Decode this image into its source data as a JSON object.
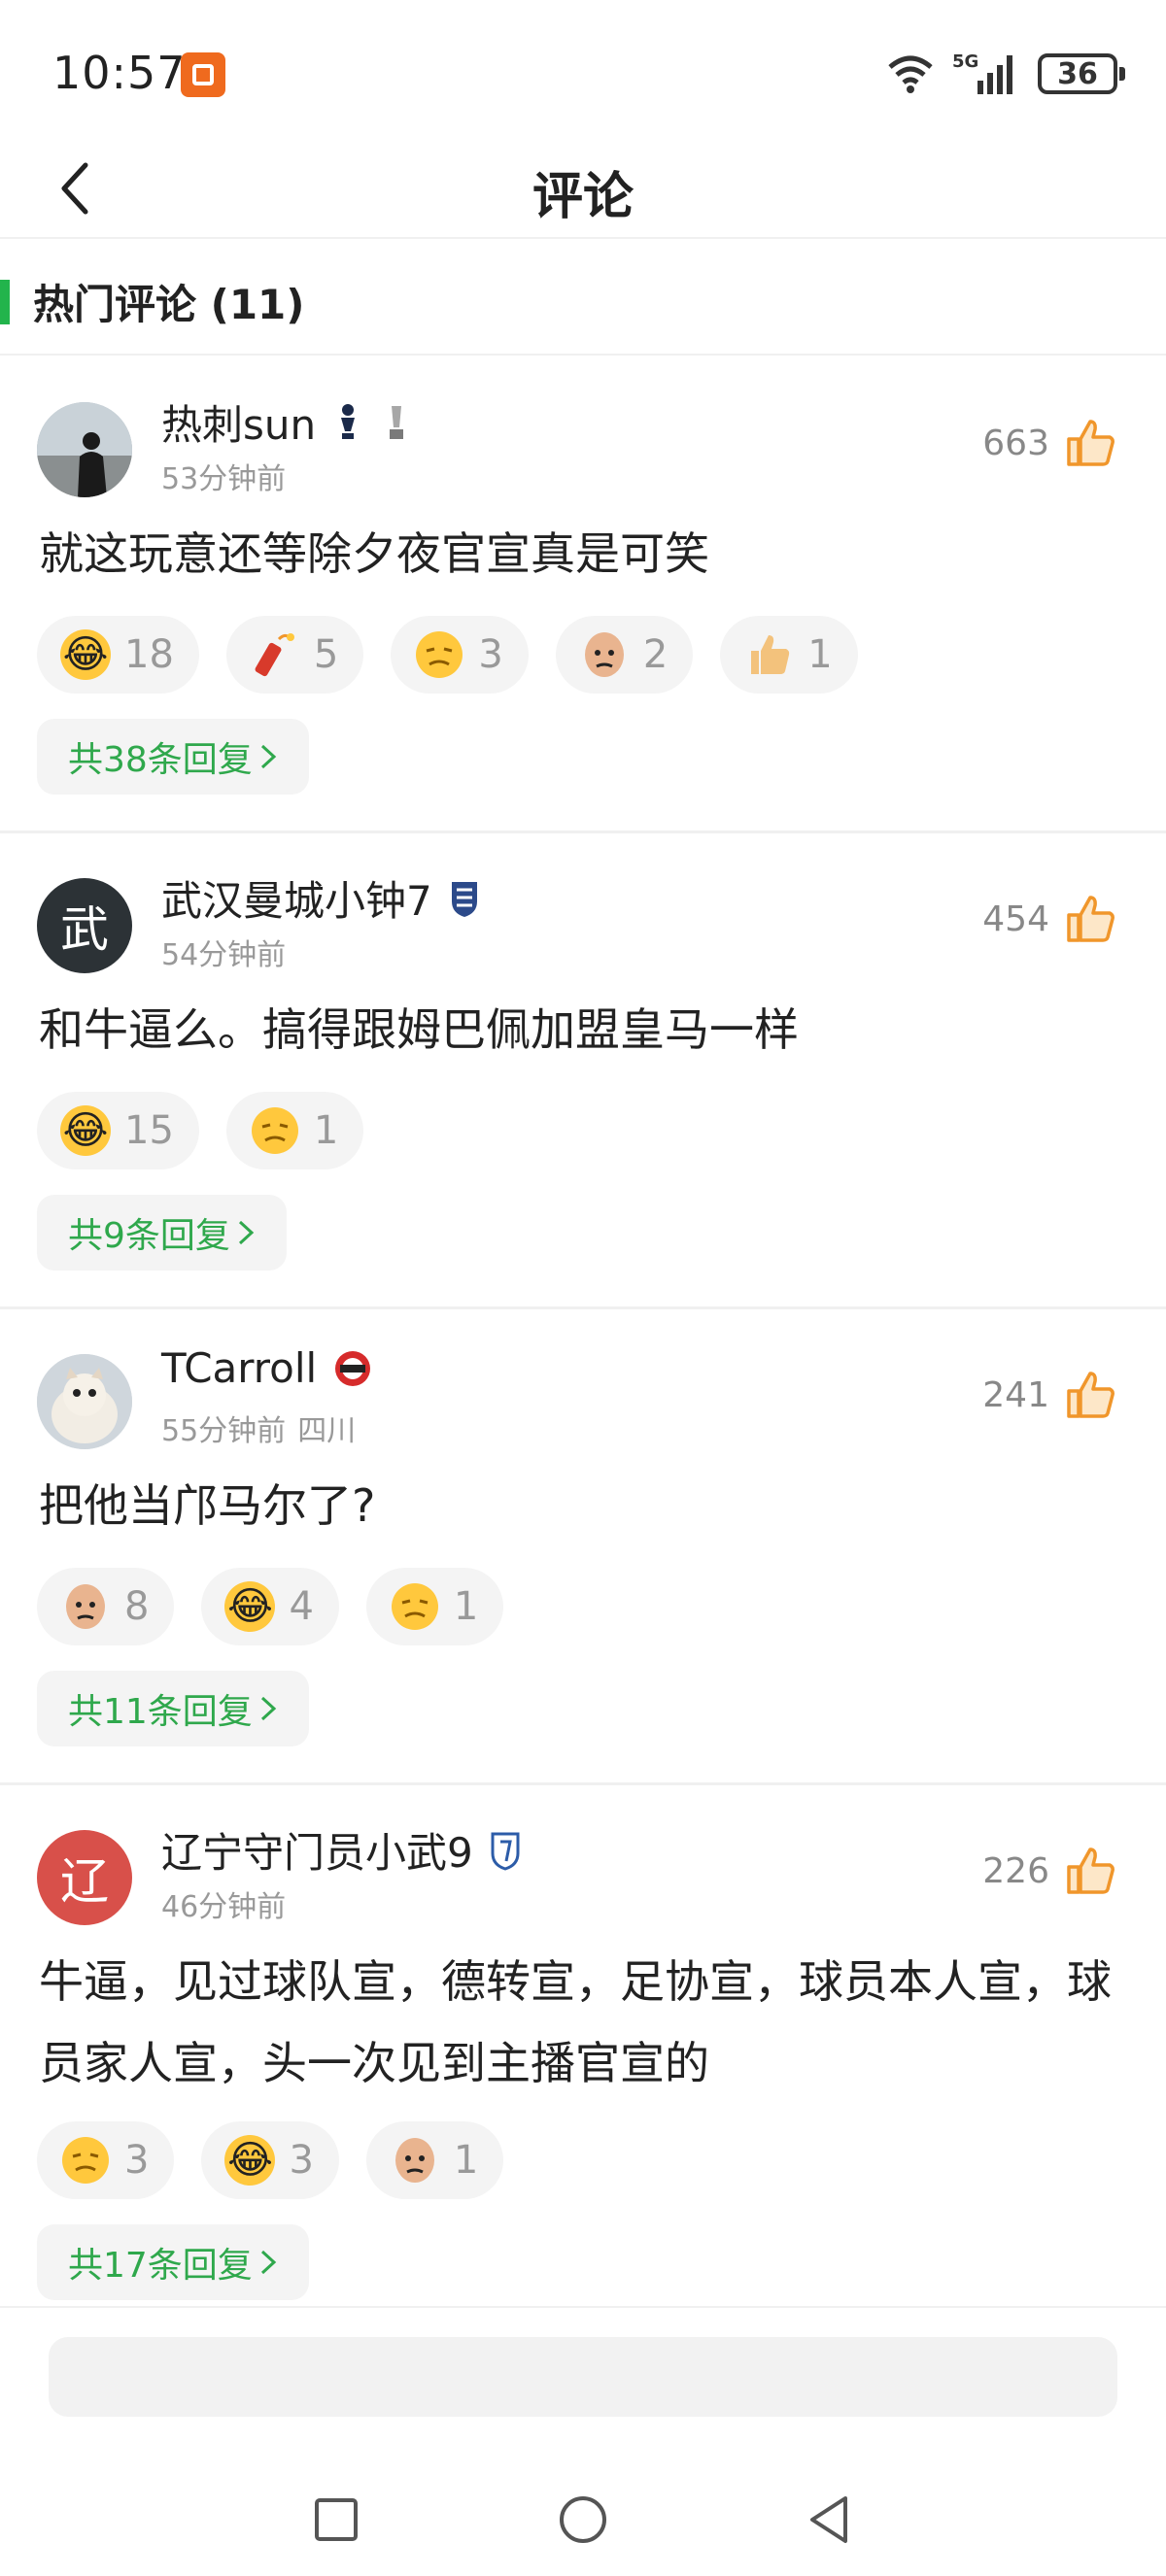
{
  "status_bar": {
    "time": "10:57",
    "signal": "5G",
    "battery": "36"
  },
  "header": {
    "title": "评论"
  },
  "section": {
    "title": "热门评论 (11)"
  },
  "comments": [
    {
      "username": "热刺sun",
      "time": "53分钟前",
      "region": "",
      "likes": "663",
      "text": "就这玩意还等除夕夜官宣真是可笑",
      "reactions": [
        {
          "emoji": "laugh-cry",
          "count": "18"
        },
        {
          "emoji": "firecracker",
          "count": "5"
        },
        {
          "emoji": "smug",
          "count": "3"
        },
        {
          "emoji": "bald-face",
          "count": "2"
        },
        {
          "emoji": "thumbs-up",
          "count": "1"
        }
      ],
      "replies": "共38条回复"
    },
    {
      "username": "武汉曼城小钟7",
      "avatar_text": "武",
      "time": "54分钟前",
      "region": "",
      "likes": "454",
      "text": "和牛逼么。搞得跟姆巴佩加盟皇马一样",
      "reactions": [
        {
          "emoji": "laugh-cry",
          "count": "15"
        },
        {
          "emoji": "smug",
          "count": "1"
        }
      ],
      "replies": "共9条回复"
    },
    {
      "username": "TCarroll",
      "time": "55分钟前",
      "region": "四川",
      "likes": "241",
      "text": "把他当邝马尔了?",
      "reactions": [
        {
          "emoji": "bald-face",
          "count": "8"
        },
        {
          "emoji": "laugh-cry",
          "count": "4"
        },
        {
          "emoji": "smug",
          "count": "1"
        }
      ],
      "replies": "共11条回复"
    },
    {
      "username": "辽宁守门员小武9",
      "avatar_text": "辽",
      "time": "46分钟前",
      "region": "",
      "likes": "226",
      "text": "牛逼，见过球队宣，德转宣，足协宣，球员本人宣，球员家人宣，头一次见到主播官宣的",
      "reactions": [
        {
          "emoji": "smug",
          "count": "3"
        },
        {
          "emoji": "laugh-cry",
          "count": "3"
        },
        {
          "emoji": "bald-face",
          "count": "1"
        }
      ],
      "replies": "共17条回复"
    }
  ],
  "colors": {
    "accent_green": "#22b44c",
    "like_orange": "#f0962b"
  }
}
